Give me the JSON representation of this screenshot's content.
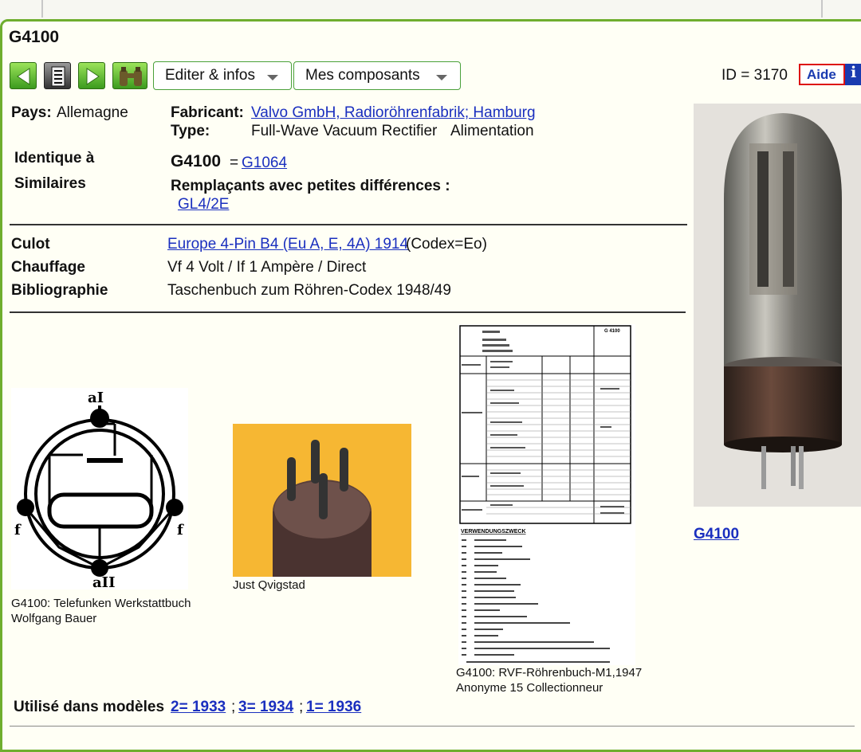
{
  "title": "G4100",
  "toolbar": {
    "icons": [
      "arrow-left-icon",
      "document-icon",
      "arrow-right-icon",
      "binoculars-icon"
    ],
    "edit_menu": "Editer & infos",
    "components_menu": "Mes composants",
    "id_text": "ID = 3170",
    "aide_label": "Aide",
    "info_label": "i"
  },
  "details": {
    "country_label": "Pays:",
    "country_value": "Allemagne",
    "maker_label": "Fabricant:",
    "maker_value": "Valvo GmbH, Radioröhrenfabrik; Hamburg",
    "type_label": "Type:",
    "type_value": "Full-Wave Vacuum Rectifier",
    "type_category": "Alimentation",
    "identical_label": "Identique à",
    "similar_label": "Similaires",
    "tube_name": "G4100",
    "equals_sign": "=",
    "equivalent_link": "G1064",
    "replacements_label": "Remplaçants avec petites différences :",
    "replacement_link": "GL4/2E"
  },
  "specs": {
    "base_label": "Culot",
    "base_link": "Europe 4-Pin B4 (Eu A, E, 4A) 1914",
    "base_code": "(Codex=Eo)",
    "heating_label": "Chauffage",
    "heating_value": "Vf 4 Volt / If 1 Ampère / Direct",
    "biblio_label": "Bibliographie",
    "biblio_value": "Taschenbuch zum Röhren-Codex 1948/49"
  },
  "images": {
    "diagram_caption1": "G4100: Telefunken Werkstattbuch",
    "diagram_caption2": "Wolfgang Bauer",
    "diagram_label_top": "aI",
    "diagram_label_bottom": "aII",
    "diagram_label_left": "f",
    "diagram_label_right": "f",
    "pins_caption": "Just Qvigstad",
    "datasheet_caption1": "G4100: RVF-Röhrenbuch-M1,1947",
    "datasheet_caption2": "Anonyme 15 Collectionneur",
    "datasheet_heading": "VERWENDUNGSZWECK",
    "datasheet_type": "G 4100",
    "photo_caption": "G4100"
  },
  "models": {
    "label": "Utilisé dans modèles",
    "links": [
      "2= 1933",
      "3= 1934",
      "1= 1936"
    ],
    "separator": ";"
  },
  "colors": {
    "panel_border": "#6fae2e",
    "link": "#1a2fbf",
    "aide_border": "#dd1111",
    "info_bg": "#1a3bb0",
    "pins_bg": "#f6b733"
  }
}
